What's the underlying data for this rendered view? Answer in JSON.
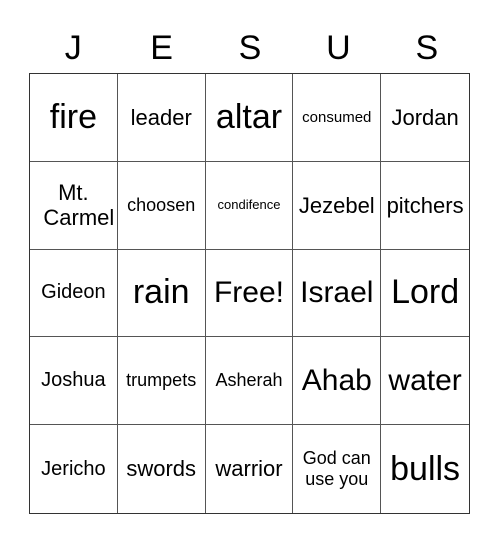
{
  "header": [
    "J",
    "E",
    "S",
    "U",
    "S"
  ],
  "cells": [
    {
      "text": "fire",
      "size": "xl"
    },
    {
      "text": "leader",
      "size": "m"
    },
    {
      "text": "altar",
      "size": "xl"
    },
    {
      "text": "consumed",
      "size": "xs"
    },
    {
      "text": "Jordan",
      "size": "m"
    },
    {
      "text": "Mt. Carmel",
      "size": "m"
    },
    {
      "text": "choosen",
      "size": "s"
    },
    {
      "text": "condifence",
      "size": "xxs"
    },
    {
      "text": "Jezebel",
      "size": "m"
    },
    {
      "text": "pitchers",
      "size": "m"
    },
    {
      "text": "Gideon",
      "size": "n"
    },
    {
      "text": "rain",
      "size": "xl"
    },
    {
      "text": "Free!",
      "size": "l"
    },
    {
      "text": "Israel",
      "size": "l"
    },
    {
      "text": "Lord",
      "size": "xl"
    },
    {
      "text": "Joshua",
      "size": "n"
    },
    {
      "text": "trumpets",
      "size": "s"
    },
    {
      "text": "Asherah",
      "size": "s"
    },
    {
      "text": "Ahab",
      "size": "l"
    },
    {
      "text": "water",
      "size": "l"
    },
    {
      "text": "Jericho",
      "size": "n"
    },
    {
      "text": "swords",
      "size": "m"
    },
    {
      "text": "warrior",
      "size": "m"
    },
    {
      "text": "God can use you",
      "size": "s"
    },
    {
      "text": "bulls",
      "size": "xl"
    }
  ]
}
